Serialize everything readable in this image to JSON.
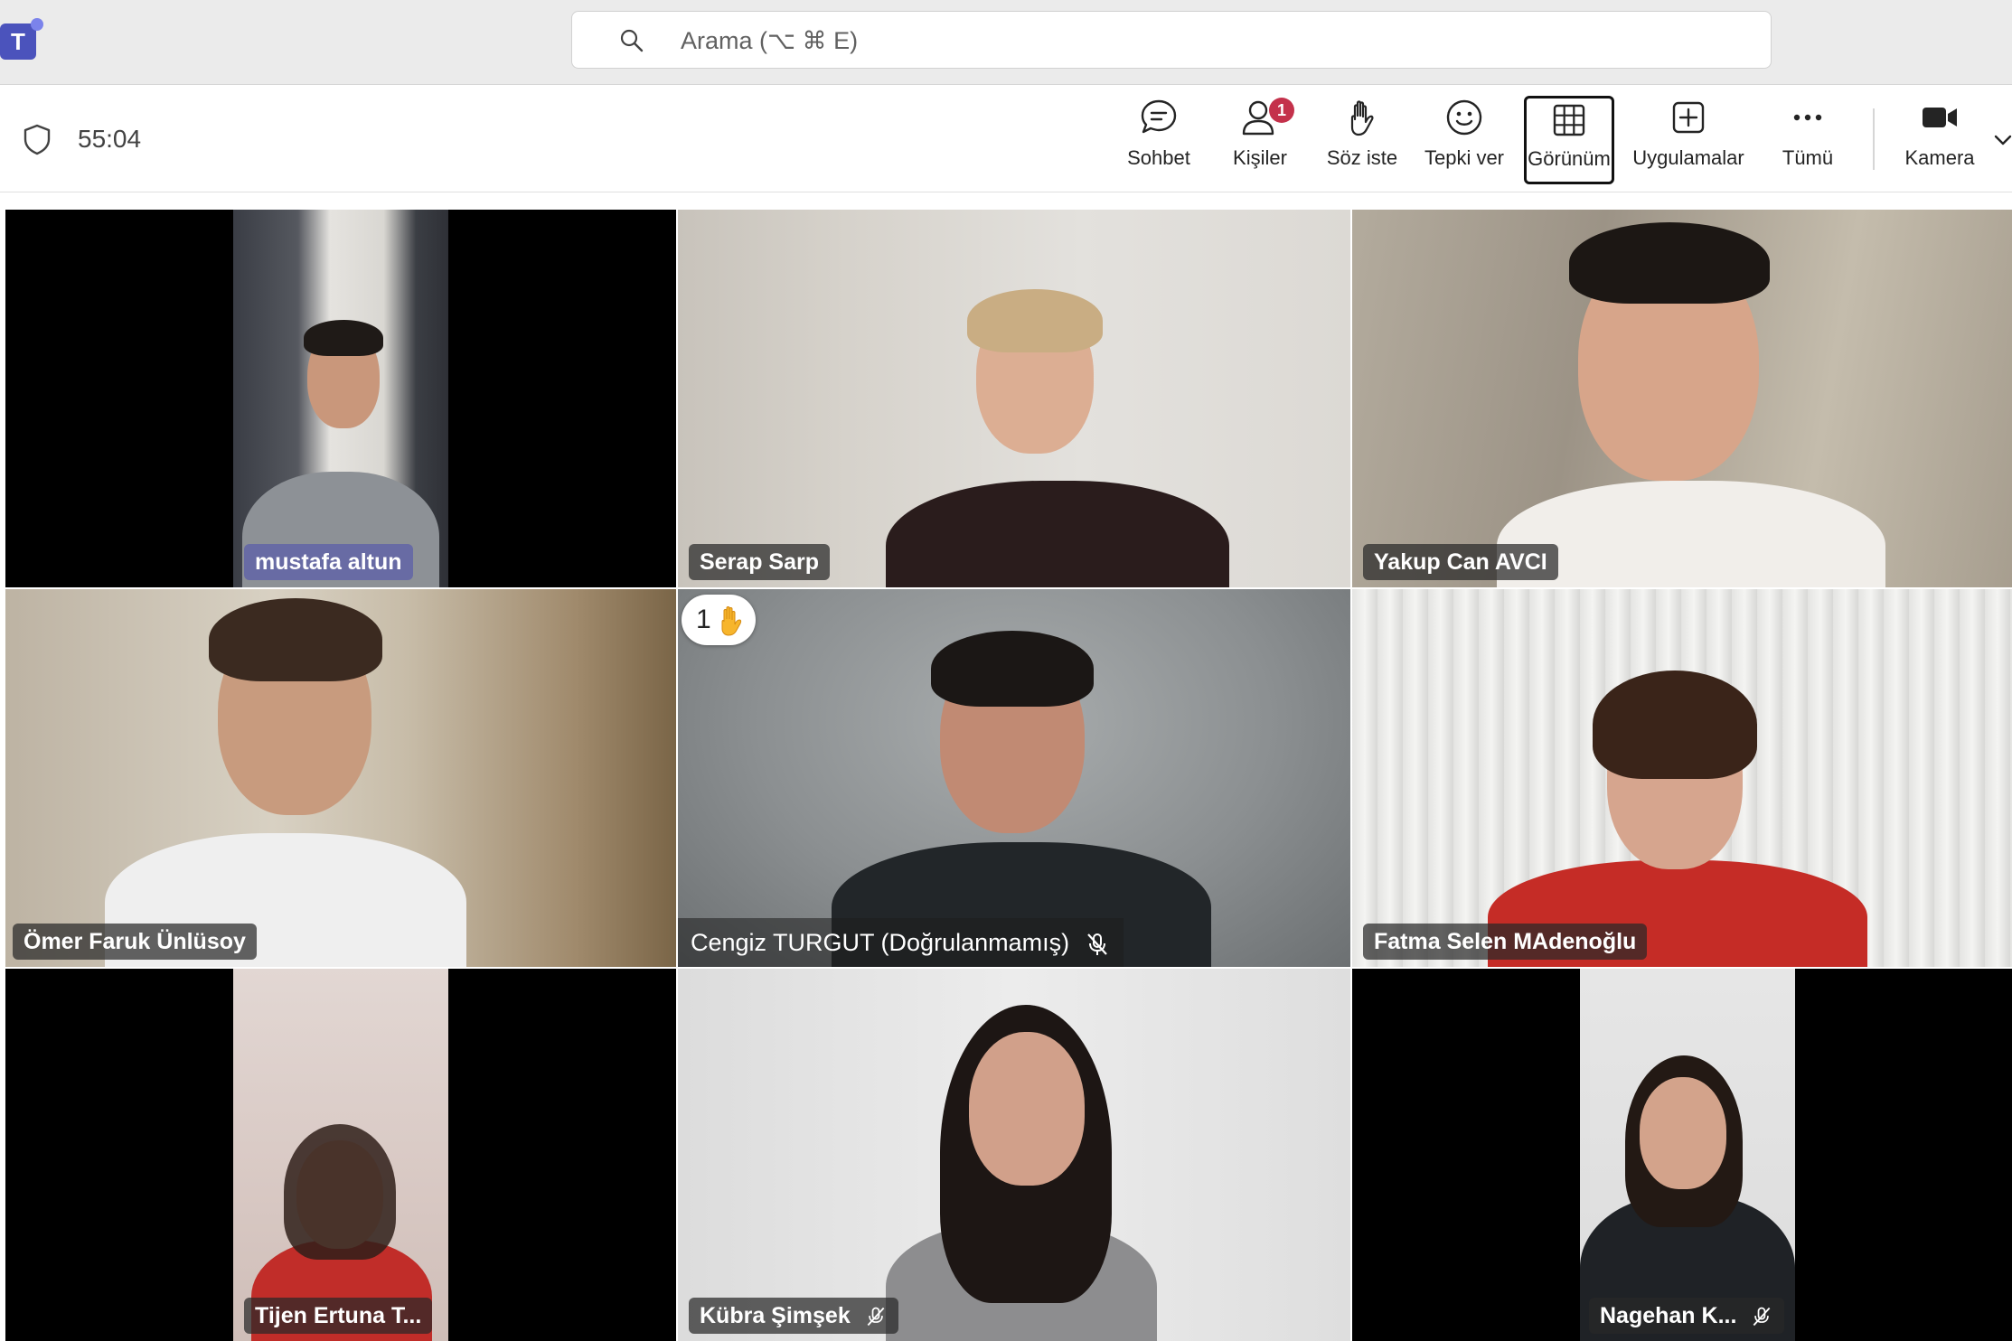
{
  "app": {
    "logo_text": "T"
  },
  "search": {
    "placeholder": "Arama (⌥ ⌘ E)"
  },
  "meeting": {
    "elapsed": "55:04"
  },
  "toolbar": {
    "chat": "Sohbet",
    "people": "Kişiler",
    "people_badge": "1",
    "raise_hand": "Söz iste",
    "react": "Tepki ver",
    "view": "Görünüm",
    "apps": "Uygulamalar",
    "more": "Tümü",
    "camera": "Kamera"
  },
  "participants": [
    {
      "name": "mustafa altun",
      "muted": false
    },
    {
      "name": "Serap Sarp",
      "muted": false
    },
    {
      "name": "Yakup Can AVCI",
      "muted": false
    },
    {
      "name": "Ömer Faruk Ünlüsoy",
      "muted": false
    },
    {
      "name": "Cengiz TURGUT (Doğrulanmamış)",
      "muted": true,
      "raise_hand_count": "1"
    },
    {
      "name": "Fatma Selen MAdenoğlu",
      "muted": false
    },
    {
      "name": "Tijen Ertuna T...",
      "muted": false
    },
    {
      "name": "Kübra Şimşek",
      "muted": true
    },
    {
      "name": "Nagehan K...",
      "muted": true
    }
  ],
  "colors": {
    "accent": "#6264a7",
    "badge": "#c4314b",
    "logo": "#4b53bc"
  }
}
